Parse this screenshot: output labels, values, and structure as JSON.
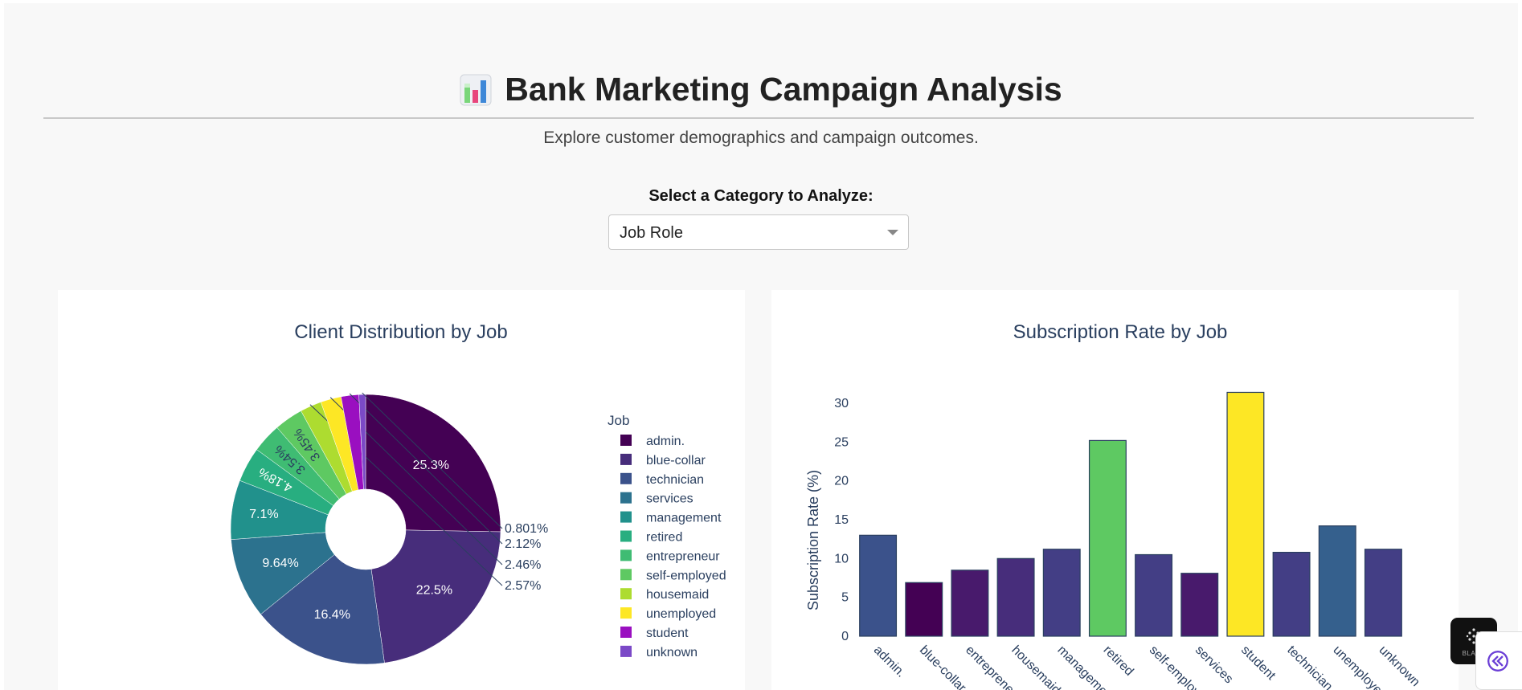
{
  "header": {
    "icon": "bar-chart-emoji-icon",
    "title": "Bank Marketing Campaign Analysis",
    "subtitle": "Explore customer demographics and campaign outcomes."
  },
  "controls": {
    "select_label": "Select a Category to Analyze:",
    "dropdown_value": "Job Role"
  },
  "colors": {
    "page_bg": "#f8f8f8",
    "chart_text": "#2a3f5f",
    "accent_purple": "#6b3fd6"
  },
  "chart_data": [
    {
      "type": "pie",
      "title": "Client Distribution by Job",
      "hole": true,
      "legend_title": "Job",
      "legend_placement": "right",
      "slices": [
        {
          "label": "admin.",
          "value": 25.3,
          "text": "25.3%",
          "color": "#440154"
        },
        {
          "label": "blue-collar",
          "value": 22.5,
          "text": "22.5%",
          "color": "#472d7b"
        },
        {
          "label": "technician",
          "value": 16.4,
          "text": "16.4%",
          "color": "#3b528b"
        },
        {
          "label": "services",
          "value": 9.64,
          "text": "9.64%",
          "color": "#2c728e"
        },
        {
          "label": "management",
          "value": 7.1,
          "text": "7.1%",
          "color": "#21918c"
        },
        {
          "label": "retired",
          "value": 4.18,
          "text": "4.18%",
          "color": "#28ae80"
        },
        {
          "label": "entrepreneur",
          "value": 3.54,
          "text": "3.54%",
          "color": "#3fbc73"
        },
        {
          "label": "self-employed",
          "value": 3.45,
          "text": "3.45%",
          "color": "#5ec962"
        },
        {
          "label": "housemaid",
          "value": 2.57,
          "text": "2.57%",
          "color": "#addc30"
        },
        {
          "label": "unemployed",
          "value": 2.46,
          "text": "2.46%",
          "color": "#fde725"
        },
        {
          "label": "student",
          "value": 2.12,
          "text": "2.12%",
          "color": "#9a0fc0"
        },
        {
          "label": "unknown",
          "value": 0.801,
          "text": "0.801%",
          "color": "#7b49c7"
        }
      ]
    },
    {
      "type": "bar",
      "title": "Subscription Rate by Job",
      "xlabel": "",
      "ylabel": "Subscription Rate (%)",
      "ylim": [
        0,
        33
      ],
      "yticks": [
        0,
        5,
        10,
        15,
        20,
        25,
        30
      ],
      "grid": false,
      "categories": [
        "admin.",
        "blue-collar",
        "entrepreneur",
        "housemaid",
        "management",
        "retired",
        "self-employed",
        "services",
        "student",
        "technician",
        "unemployed",
        "unknown"
      ],
      "values": [
        13.0,
        6.9,
        8.5,
        10.0,
        11.2,
        25.2,
        10.5,
        8.1,
        31.4,
        10.8,
        14.2,
        11.2
      ],
      "colors": [
        "#3b528b",
        "#440154",
        "#481a6c",
        "#472d7b",
        "#433e85",
        "#5ec962",
        "#433e85",
        "#481a6c",
        "#fde725",
        "#433e85",
        "#35608d",
        "#433e85"
      ]
    }
  ],
  "widgets": {
    "brand_text": "BLACK"
  }
}
